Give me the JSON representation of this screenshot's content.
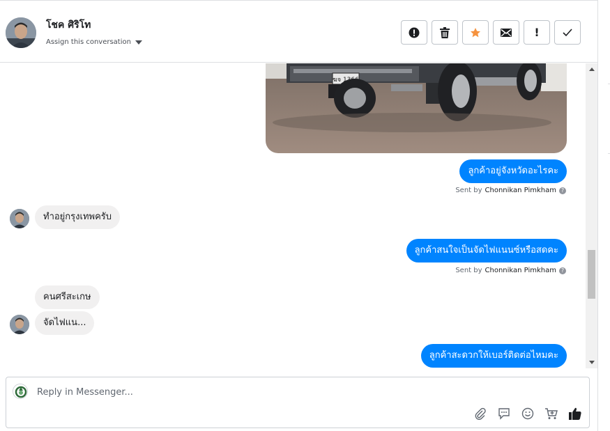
{
  "header": {
    "contact_name": "โชค ศิริโท",
    "assign_label": "Assign this conversation",
    "actions": [
      {
        "icon": "exclamation-circle-icon",
        "glyph": "!"
      },
      {
        "icon": "trash-icon",
        "glyph": ""
      },
      {
        "icon": "star-icon",
        "glyph": "★"
      },
      {
        "icon": "envelope-icon",
        "glyph": ""
      },
      {
        "icon": "exclamation-icon",
        "glyph": "!"
      },
      {
        "icon": "checkmark-icon",
        "glyph": "✓"
      }
    ]
  },
  "photo": {
    "plate_text": "ฆจ 1366"
  },
  "messages": [
    {
      "direction": "out",
      "text": "ลูกค้าอยู่จังหวัดอะไรคะ",
      "sent_by_prefix": "Sent by",
      "sender": "Chonnikan Pimkham"
    },
    {
      "direction": "in",
      "text": "ทำอยู่กรุงเทพครับ"
    },
    {
      "direction": "out",
      "text": "ลูกค้าสนใจเป็นจัดไฟแนนซ์หรือสดคะ",
      "sent_by_prefix": "Sent by",
      "sender": "Chonnikan Pimkham"
    },
    {
      "direction": "in",
      "text": "คนศรีสะเกษ"
    },
    {
      "direction": "in",
      "text": "จัดไฟแน..."
    },
    {
      "direction": "out",
      "text": "ลูกค้าสะดวกให้เบอร์ติดต่อไหมคะ"
    }
  ],
  "composer": {
    "placeholder": "Reply in Messenger...",
    "tools": [
      "paperclip-icon",
      "chat-bubble-icon",
      "smiley-icon",
      "cart-icon",
      "thumbs-up-icon"
    ]
  },
  "colors": {
    "accent_blue": "#0084ff",
    "incoming_bg": "#f1f0f0",
    "star_orange": "#f5923e"
  }
}
